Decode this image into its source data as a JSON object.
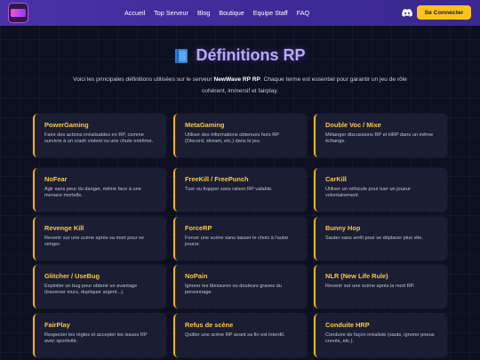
{
  "nav": {
    "links": [
      "Accueil",
      "Top Serveur",
      "Blog",
      "Boutique",
      "Equipe Staff",
      "FAQ"
    ],
    "login_label": "Se Connecter"
  },
  "hero": {
    "title": "Définitions RP",
    "intro_before": "Voici les principales définitions utilisées sur le serveur ",
    "intro_bold": "NewWave RP RP",
    "intro_after": ". Chaque terme est essentiel pour garantir un jeu de rôle cohérent, immersif et fairplay."
  },
  "definitions": [
    {
      "term": "PowerGaming",
      "desc": "Faire des actions irréalisables en RP, comme survivre à un crash violent ou une chute extrême."
    },
    {
      "term": "MetaGaming",
      "desc": "Utiliser des informations obtenues hors RP (Discord, stream, etc.) dans le jeu."
    },
    {
      "term": "Double Voc / Mixe",
      "desc": "Mélanger discussions RP et HRP dans un même échange."
    },
    {
      "term": "NoFear",
      "desc": "Agir sans peur du danger, même face à une menace mortelle."
    },
    {
      "term": "FreeKill / FreePunch",
      "desc": "Tuer ou frapper sans raison RP valable."
    },
    {
      "term": "CarKill",
      "desc": "Utiliser un véhicule pour tuer un joueur volontairement."
    },
    {
      "term": "Revenge Kill",
      "desc": "Revenir sur une scène après sa mort pour se venger."
    },
    {
      "term": "ForceRP",
      "desc": "Forcer une scène sans laisser le choix à l'autre joueur."
    },
    {
      "term": "Bunny Hop",
      "desc": "Sauter sans arrêt pour se déplacer plus vite."
    },
    {
      "term": "Glitcher / UseBug",
      "desc": "Exploiter un bug pour obtenir un avantage (traverser murs, dupliquer argent...)."
    },
    {
      "term": "NoPain",
      "desc": "Ignorer les blessures ou douleurs graves du personnage."
    },
    {
      "term": "NLR (New Life Rule)",
      "desc": "Revenir sur une scène après la mort RP."
    },
    {
      "term": "FairPlay",
      "desc": "Respecter les règles et accepter les issues RP avec sportivité."
    },
    {
      "term": "Refus de scène",
      "desc": "Quitter une scène RP avant sa fin est interdit."
    },
    {
      "term": "Conduite HRP",
      "desc": "Conduire de façon irréaliste (sauts, ignorer pneus crevés, etc.)."
    }
  ],
  "colors": {
    "accent": "#ffb21c",
    "nav_bg": "#4a32a8",
    "title": "#b9a8ff"
  }
}
